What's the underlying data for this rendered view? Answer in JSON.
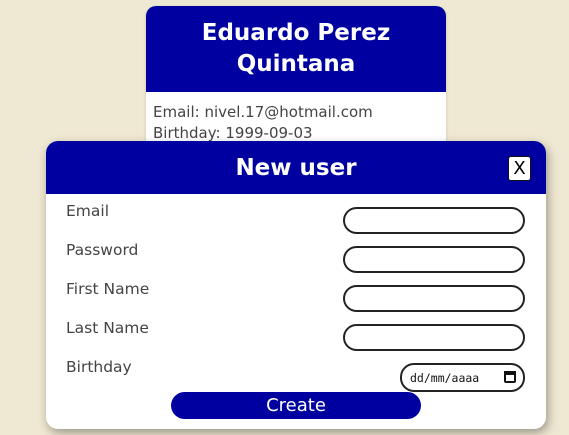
{
  "profile": {
    "name": "Eduardo Perez Quintana",
    "email_label": "Email:",
    "email": "nivel.17@hotmail.com",
    "birthday_label": "Birthday:",
    "birthday": "1999-09-03"
  },
  "modal": {
    "title": "New user",
    "close_label": "X",
    "fields": {
      "email": {
        "label": "Email",
        "value": ""
      },
      "password": {
        "label": "Password",
        "value": ""
      },
      "first_name": {
        "label": "First Name",
        "value": ""
      },
      "last_name": {
        "label": "Last Name",
        "value": ""
      },
      "birthday": {
        "label": "Birthday",
        "placeholder": "dd/mm/aaaa"
      }
    },
    "submit_label": "Create"
  },
  "colors": {
    "primary": "#0000a0",
    "background": "#efe8d2"
  }
}
